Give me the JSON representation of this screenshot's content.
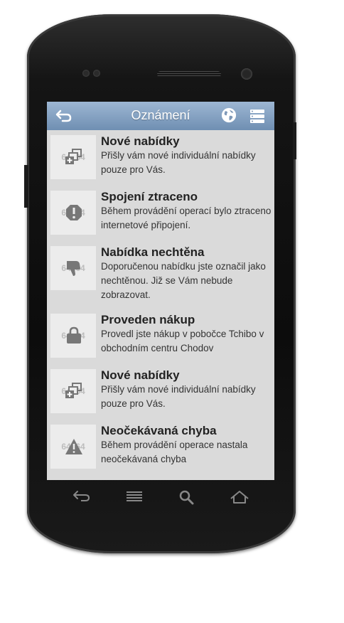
{
  "header": {
    "title": "Oznámení"
  },
  "notifications": [
    {
      "title": "Nové nabídky",
      "desc": "Přišly vám nové individuální nabídky pouze pro Vás.",
      "placeholder": "64x64",
      "icon": "new-offers-icon"
    },
    {
      "title": "Spojení ztraceno",
      "desc": "Během provádění operací bylo ztraceno internetové připojení.",
      "placeholder": "64x64",
      "icon": "connection-lost-icon"
    },
    {
      "title": "Nabídka nechtěna",
      "desc": "Doporučenou nabídku jste označil jako nechtěnou. Již se Vám nebude zobrazovat.",
      "placeholder": "64x64",
      "icon": "thumbs-down-icon"
    },
    {
      "title": "Proveden nákup",
      "desc": "Provedl jste nákup v pobočce Tchibo v obchodním centru Chodov",
      "placeholder": "64x64",
      "icon": "shopping-bag-icon"
    },
    {
      "title": "Nové nabídky",
      "desc": "Přišly vám nové individuální nabídky pouze pro Vás.",
      "placeholder": "64x64",
      "icon": "new-offers-icon"
    },
    {
      "title": "Neočekávaná chyba",
      "desc": "Během provádění operace nastala neočekávaná chyba",
      "placeholder": "64x64",
      "icon": "warning-icon"
    }
  ],
  "colors": {
    "header_top": "#9db7d3",
    "header_bottom": "#6f8fb2",
    "list_bg": "#dadada"
  }
}
